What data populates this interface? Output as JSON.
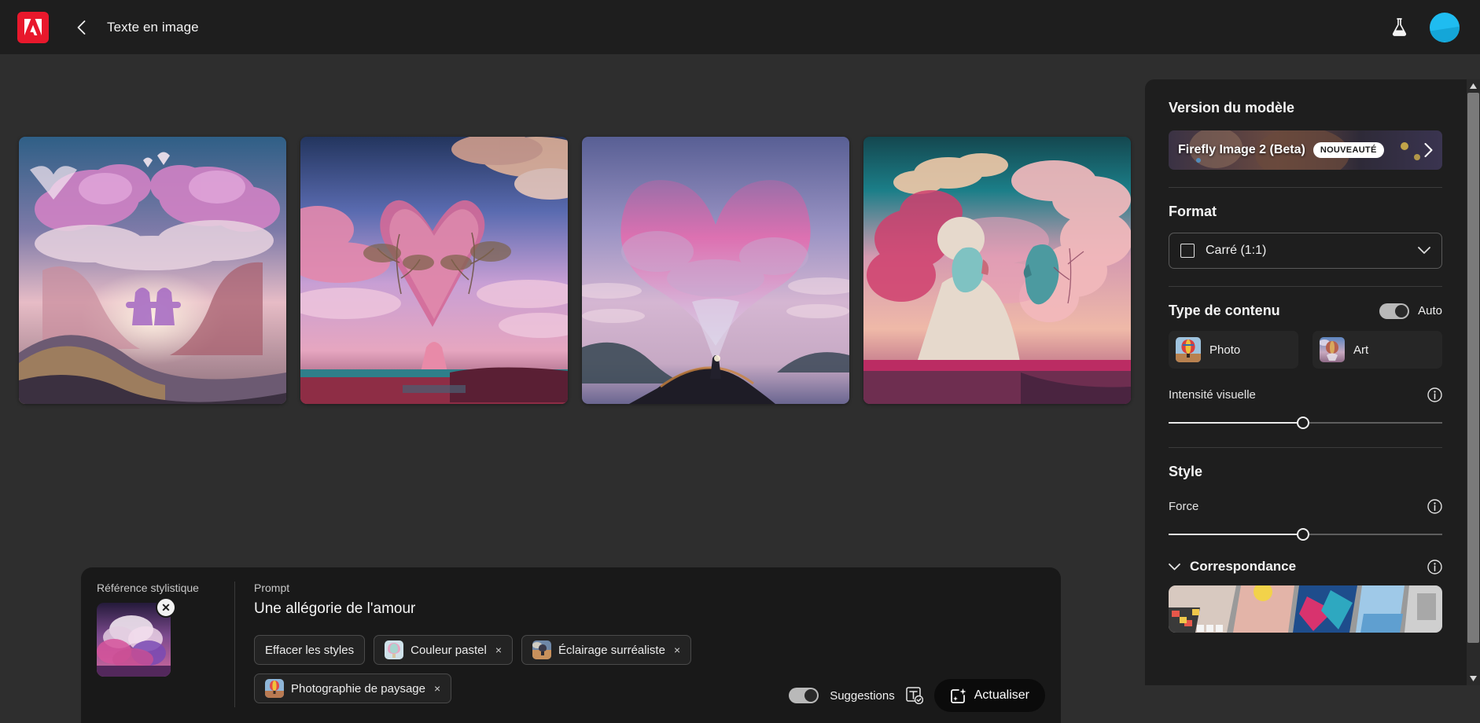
{
  "topbar": {
    "logo_icon": "adobe-logo-icon",
    "back_icon": "chevron-left-icon",
    "title": "Texte en image",
    "flask_icon": "flask-icon",
    "avatar_icon": "user-avatar"
  },
  "gallery": {
    "images": [
      {
        "alt": "Nuages roses en forme de coeur au-dessus d'une montagne avec deux silhouettes"
      },
      {
        "alt": "Arbres et nuages formant un coeur au coucher de soleil"
      },
      {
        "alt": "Grand nuage en forme de coeur avec une silhouette sur une colline"
      },
      {
        "alt": "Deux bustes sculptes face a face entoures de nuages roses"
      }
    ]
  },
  "prompt_bar": {
    "reference_label": "Référence stylistique",
    "reference_remove_icon": "close-circle-icon",
    "prompt_label": "Prompt",
    "prompt_text": "Une allégorie de l'amour",
    "chips": [
      {
        "label": "Effacer les styles",
        "has_thumb": false,
        "has_close": false
      },
      {
        "label": "Couleur pastel",
        "has_thumb": true,
        "has_close": true,
        "close": "×"
      },
      {
        "label": "Éclairage surréaliste",
        "has_thumb": true,
        "has_close": true,
        "close": "×"
      },
      {
        "label": "Photographie de paysage",
        "has_thumb": true,
        "has_close": true,
        "close": "×"
      }
    ],
    "suggestions_label": "Suggestions",
    "suggestions_on": true,
    "suggestions_icon": "text-check-icon",
    "refresh_label": "Actualiser",
    "refresh_icon": "sparkle-image-icon"
  },
  "right_panel": {
    "model": {
      "section_title": "Version du modèle",
      "name": "Firefly Image 2 (Beta)",
      "badge": "NOUVEAUTÉ",
      "chevron_icon": "chevron-right-icon"
    },
    "format": {
      "section_title": "Format",
      "value": "Carré (1:1)",
      "icon": "square-icon",
      "chevron_icon": "chevron-down-icon"
    },
    "content_type": {
      "section_title": "Type de contenu",
      "auto_label": "Auto",
      "auto_on": true,
      "options": [
        {
          "label": "Photo"
        },
        {
          "label": "Art"
        }
      ]
    },
    "visual_intensity": {
      "label": "Intensité visuelle",
      "info_icon": "info-icon",
      "value_percent": 49
    },
    "style": {
      "section_title": "Style",
      "force_label": "Force",
      "force_info_icon": "info-icon",
      "force_value_percent": 49,
      "correspondance_label": "Correspondance",
      "correspondance_info_icon": "info-icon",
      "correspondance_chevron_icon": "chevron-down-icon"
    }
  },
  "scrollbar": {
    "up_icon": "triangle-up-icon",
    "down_icon": "triangle-down-icon"
  },
  "colors": {
    "accent_red": "#e8182c",
    "panel_bg": "#1e1e1e",
    "canvas_bg": "#2e2e2e",
    "avatar_cyan": "#1fbcf0"
  }
}
